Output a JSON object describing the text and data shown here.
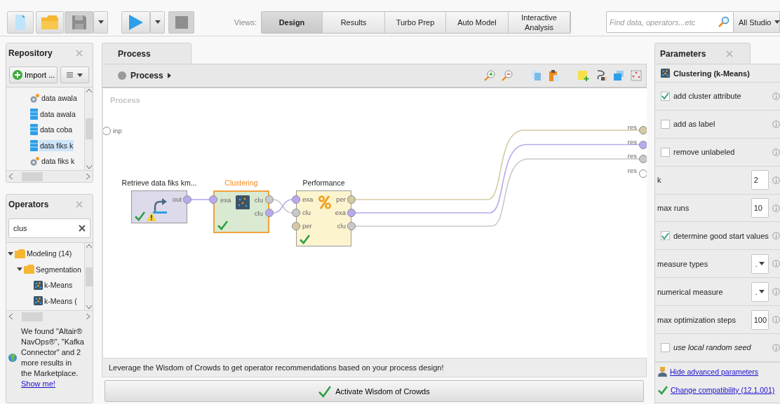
{
  "toolbar": {
    "views_label": "Views:",
    "views": [
      {
        "label": "Design",
        "selected": true
      },
      {
        "label": "Results",
        "selected": false
      },
      {
        "label": "Turbo Prep",
        "selected": false
      },
      {
        "label": "Auto Model",
        "selected": false
      },
      {
        "label": "Interactive Analysis",
        "selected": false
      }
    ],
    "search": {
      "placeholder": "Find data, operators...etc"
    },
    "scope": "All Studio"
  },
  "repository": {
    "title": "Repository",
    "import_button": "Import ...",
    "items": [
      {
        "label": "data awala",
        "kind": "process",
        "selected": false
      },
      {
        "label": "data awala",
        "kind": "data",
        "selected": false
      },
      {
        "label": "data coba",
        "kind": "data",
        "selected": false
      },
      {
        "label": "data fiks k",
        "kind": "data",
        "selected": true
      },
      {
        "label": "data fiks k",
        "kind": "process",
        "selected": false
      }
    ]
  },
  "operators": {
    "title": "Operators",
    "search": {
      "value": "clus"
    },
    "tree": [
      {
        "label": "Modeling (14)",
        "kind": "folder",
        "expanded": true,
        "children": [
          {
            "label": "Segmentation",
            "kind": "folder",
            "expanded": true,
            "children": [
              {
                "label": "k-Means",
                "kind": "operator"
              },
              {
                "label": "k-Means (",
                "kind": "operator"
              }
            ]
          }
        ]
      }
    ],
    "marketplace": {
      "message": "We found \"Altair® NavOps®\", \"Kafka Connector\" and 2 more results in the Marketplace.",
      "link": "Show me!"
    }
  },
  "process": {
    "tab": "Process",
    "breadcrumb": "Process",
    "canvas_title": "Process",
    "input_ports": [
      {
        "label": "inp",
        "color": "#ffffff"
      }
    ],
    "result_ports": [
      {
        "label": "res",
        "color": "#d4cba3"
      },
      {
        "label": "res",
        "color": "#b8a9ef"
      },
      {
        "label": "res",
        "color": "#c9c9c9"
      },
      {
        "label": "res",
        "color": "#ffffff"
      }
    ],
    "operators": [
      {
        "title": "Retrieve data fiks km...",
        "kind": "retrieve",
        "selected": false,
        "ok": true,
        "warning": true,
        "outputs": [
          {
            "label": "out",
            "color": "#b8a9ef"
          }
        ]
      },
      {
        "title": "Clustering",
        "kind": "clustering",
        "selected": true,
        "ok": true,
        "warning": false,
        "inputs": [
          {
            "label": "exa",
            "color": "#b8a9ef"
          }
        ],
        "outputs": [
          {
            "label": "clu",
            "color": "#c9c9c9"
          },
          {
            "label": "clu",
            "color": "#b8a9ef"
          }
        ]
      },
      {
        "title": "Performance",
        "kind": "performance",
        "selected": false,
        "ok": true,
        "warning": false,
        "inputs": [
          {
            "label": "exa",
            "color": "#b8a9ef"
          },
          {
            "label": "clu",
            "color": "#c9c9c9"
          },
          {
            "label": "per",
            "color": "#d4cba3"
          }
        ],
        "outputs": [
          {
            "label": "per",
            "color": "#d4cba3"
          },
          {
            "label": "exa",
            "color": "#b8a9ef"
          },
          {
            "label": "clu",
            "color": "#c9c9c9"
          }
        ]
      }
    ]
  },
  "wisdom": {
    "message": "Leverage the Wisdom of Crowds to get operator recommendations based on your process design!",
    "button": "Activate Wisdom of Crowds"
  },
  "parameters": {
    "title": "Parameters",
    "operator": "Clustering (k-Means)",
    "items": [
      {
        "kind": "checkbox",
        "label": "add cluster attribute",
        "checked": true,
        "expert": false
      },
      {
        "kind": "checkbox",
        "label": "add as label",
        "checked": false,
        "expert": false
      },
      {
        "kind": "checkbox",
        "label": "remove unlabeled",
        "checked": false,
        "expert": false
      },
      {
        "kind": "number",
        "label": "k",
        "value": "2",
        "expert": false
      },
      {
        "kind": "number",
        "label": "max runs",
        "value": "10",
        "expert": false
      },
      {
        "kind": "checkbox",
        "label": "determine good start values",
        "checked": true,
        "expert": false
      },
      {
        "kind": "select",
        "label": "measure types",
        "value": ".",
        "expert": false
      },
      {
        "kind": "select",
        "label": "numerical measure",
        "value": ".",
        "expert": false
      },
      {
        "kind": "number",
        "label": "max optimization steps",
        "value": "100",
        "expert": false
      },
      {
        "kind": "checkbox",
        "label": "use local random seed",
        "checked": false,
        "expert": true
      }
    ],
    "links": [
      {
        "label": "Hide advanced parameters",
        "kind": "advanced"
      },
      {
        "label": "Change compatibility (12.1.001)",
        "kind": "compatibility"
      }
    ]
  }
}
